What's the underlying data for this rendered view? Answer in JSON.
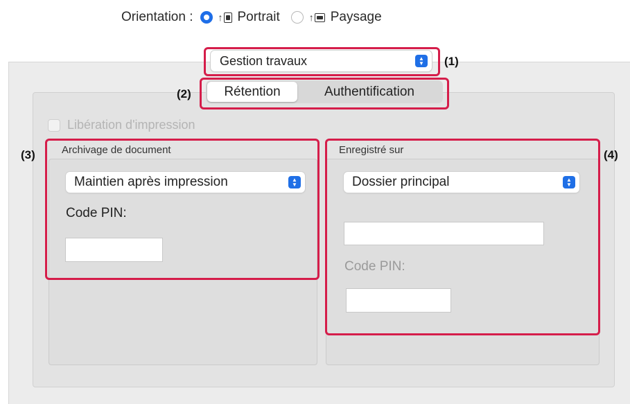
{
  "orientation": {
    "label": "Orientation :",
    "options": [
      {
        "label": "Portrait",
        "selected": true
      },
      {
        "label": "Paysage",
        "selected": false
      }
    ]
  },
  "panel_popup": {
    "value": "Gestion travaux"
  },
  "tabs": [
    {
      "label": "Rétention",
      "selected": true
    },
    {
      "label": "Authentification",
      "selected": false
    }
  ],
  "print_release": {
    "label": "Libération d'impression",
    "checked": false,
    "enabled": false
  },
  "document_filing": {
    "title": "Archivage de document",
    "mode_value": "Maintien après impression",
    "pin_label": "Code PIN:",
    "pin_value": ""
  },
  "stored_to": {
    "title": "Enregistré sur",
    "folder_value": "Dossier principal",
    "folder_name_value": "",
    "pin_label": "Code PIN:",
    "pin_value": ""
  },
  "annotations": [
    "(1)",
    "(2)",
    "(3)",
    "(4)"
  ],
  "colors": {
    "accent": "#1f6fe6",
    "annotation": "#d51d4a"
  }
}
